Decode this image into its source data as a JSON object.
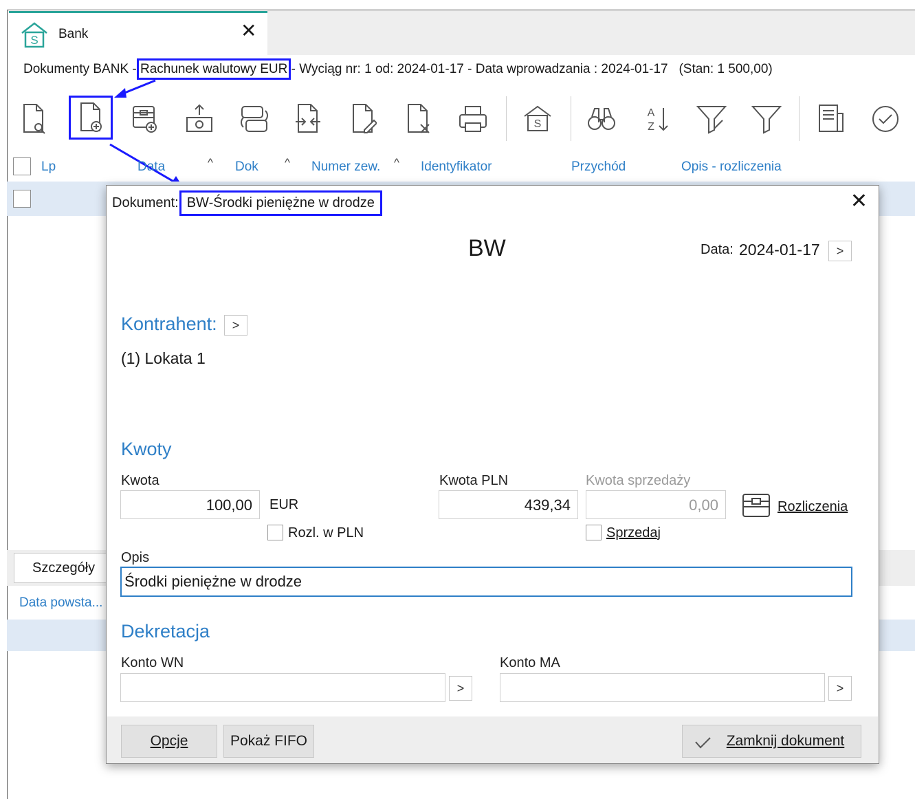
{
  "tab": {
    "title": "Bank",
    "close": "✕"
  },
  "header": {
    "prefix": "Dokumenty BANK - ",
    "account": "Rachunek walutowy EUR",
    "rest": " - Wyciąg nr: 1 od: 2024-01-17 - Data wprowadzania : 2024-01-17   (Stan: 1 500,00)"
  },
  "toolbar": {
    "icons": [
      "preview-document-icon",
      "add-document-icon",
      "add-cashbox-icon",
      "payout-icon",
      "currency-exchange-icon",
      "import-export-icon",
      "edit-document-icon",
      "delete-document-icon",
      "print-icon",
      "bank-icon",
      "binoculars-icon",
      "sort-az-icon",
      "filter-clear-icon",
      "filter-icon",
      "report-icon",
      "confirm-icon"
    ]
  },
  "grid": {
    "columns": [
      "Lp",
      "Data",
      "Dok",
      "Numer zew.",
      "Identyfikator",
      "Przychód",
      "Opis - rozliczenia"
    ],
    "sort_glyph": "^"
  },
  "lower": {
    "tab": "Szczegóły",
    "data_label": "Data powsta..."
  },
  "dialog": {
    "title_label": "Dokument:",
    "title_value": "BW-Środki pieniężne w drodze",
    "close": "✕",
    "doc_code": "BW",
    "date_label": "Data:",
    "date_value": "2024-01-17",
    "arrow": ">",
    "kontrahent_label": "Kontrahent:",
    "kontrahent_value": "(1) Lokata 1",
    "kwoty_label": "Kwoty",
    "kwota_label": "Kwota",
    "kwota_value": "100,00",
    "currency": "EUR",
    "kwota_pln_label": "Kwota PLN",
    "kwota_pln_value": "439,34",
    "kwota_sprz_label": "Kwota sprzedaży",
    "kwota_sprz_value": "0,00",
    "rozliczenia": "Rozliczenia",
    "rozl_pln": "Rozl. w PLN",
    "sprzedaj": "Sprzedaj",
    "opis_label": "Opis",
    "opis_value": "Środki pieniężne w drodze",
    "dekretacja_label": "Dekretacja",
    "konto_wn_label": "Konto WN",
    "konto_ma_label": "Konto MA",
    "konto_wn_value": "",
    "konto_ma_value": "",
    "btn_opcje": "Opcje",
    "btn_fifo": "Pokaż FIFO",
    "btn_zamknij": "Zamknij dokument"
  },
  "colors": {
    "accent": "#2e7fc7",
    "highlight": "#1a1aff",
    "tab_top": "#2aa59a",
    "row_selected": "#dfe9f5"
  }
}
